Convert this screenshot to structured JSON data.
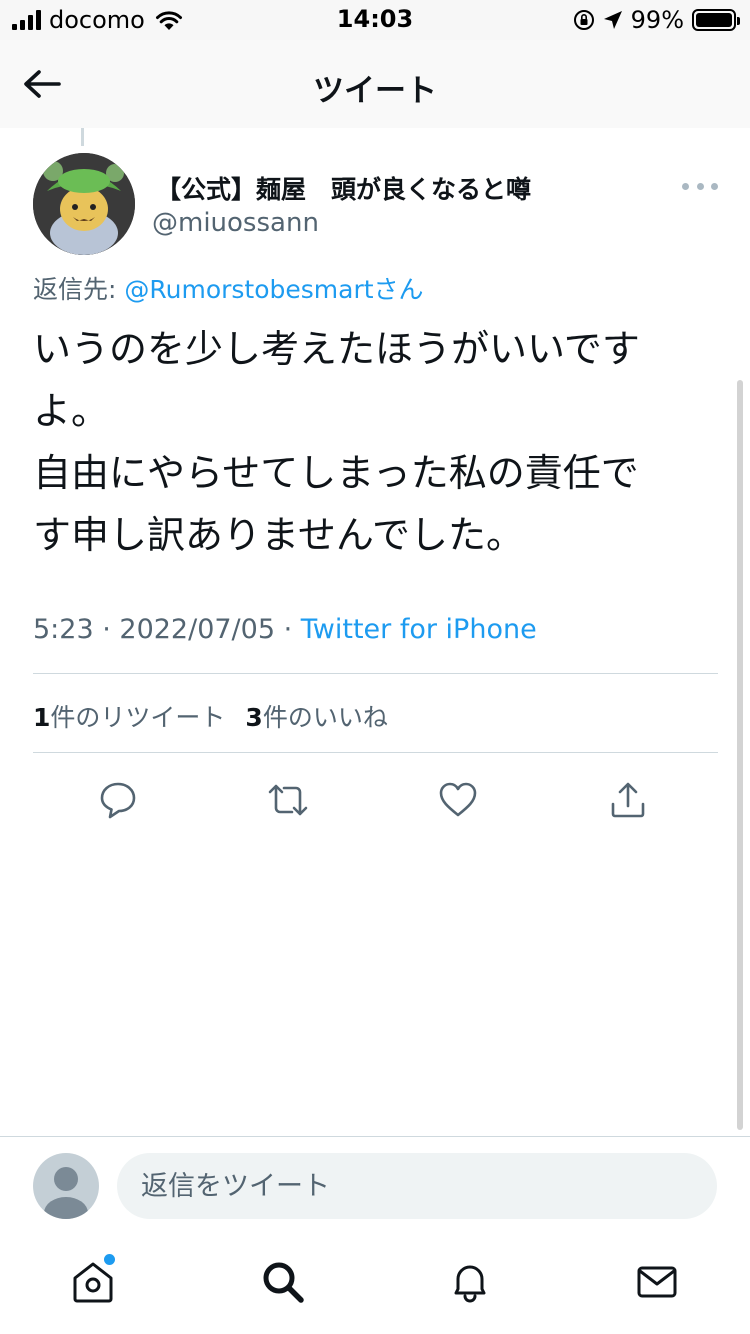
{
  "status_bar": {
    "carrier": "docomo",
    "time": "14:03",
    "battery": "99%",
    "battery_level": 0.99
  },
  "header": {
    "title": "ツイート"
  },
  "tweet": {
    "display_name": "【公式】麺屋　頭が良くなると噂",
    "handle": "@miuossann",
    "reply_prefix": "返信先: ",
    "reply_mention": "@Rumorstobesmartさん",
    "lines": [
      "いうのを少し考えたほうがいいです",
      "よ。",
      "自由にやらせてしまった私の責任で",
      "す申し訳ありませんでした。"
    ],
    "time": "5:23",
    "date": "2022/07/05",
    "separator": " · ",
    "source": "Twitter for iPhone",
    "retweet_count": "1",
    "retweet_label": "件のリツイート",
    "like_count": "3",
    "like_label": "件のいいね"
  },
  "reply_bar": {
    "placeholder": "返信をツイート"
  },
  "icons": {
    "back": "arrow-left-icon",
    "more": "more-horizontal-icon",
    "reply": "comment-icon",
    "retweet": "retweet-icon",
    "like": "heart-icon",
    "share": "share-icon",
    "home": "home-icon",
    "search": "search-icon",
    "notifications": "bell-icon",
    "messages": "envelope-icon"
  },
  "colors": {
    "accent": "#1d9bf0",
    "secondary_text": "#536471",
    "divider": "#cfd9de"
  }
}
